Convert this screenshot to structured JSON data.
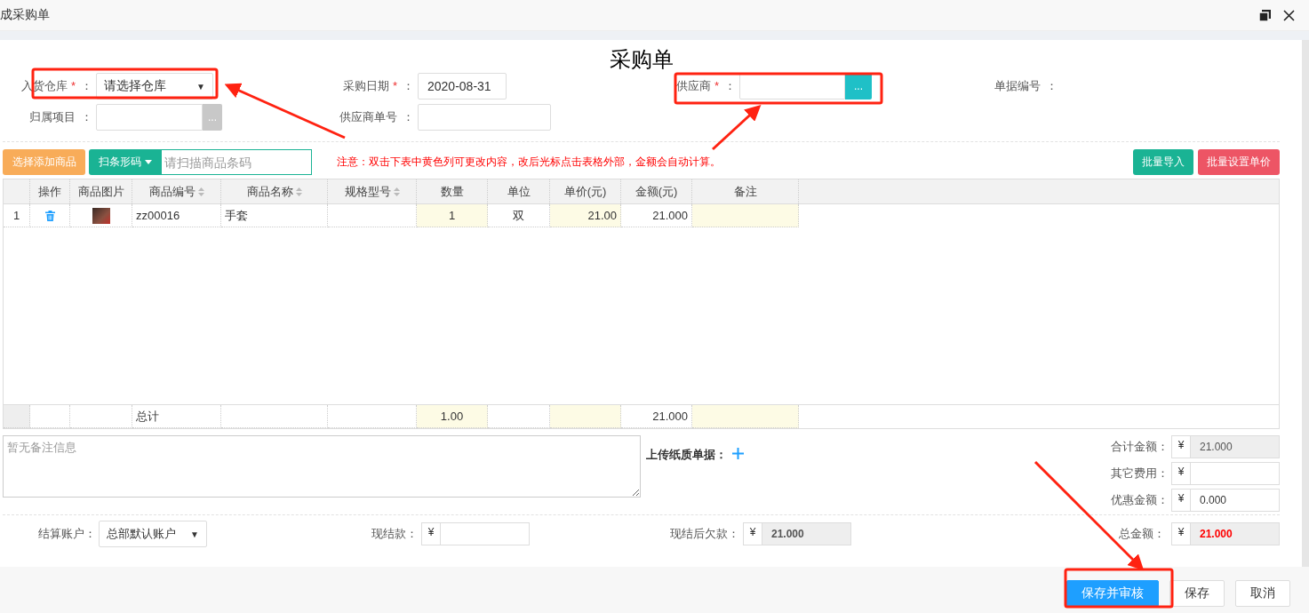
{
  "window": {
    "title": "成采购单"
  },
  "form": {
    "title": "采购单",
    "fields": [
      {
        "label": "入货仓库",
        "required_mark": "*",
        "colon": "：",
        "kind": "select",
        "value": "请选择仓库",
        "caret": "▼"
      },
      {
        "label": "采购日期",
        "required_mark": "*",
        "colon": "：",
        "kind": "text",
        "value": "2020-08-31"
      },
      {
        "label": "供应商",
        "required_mark": "*",
        "colon": "：",
        "kind": "lookup",
        "button": "..."
      },
      {
        "label": "单据编号",
        "colon": "：",
        "kind": "static"
      },
      {
        "label": "归属项目",
        "colon": "：",
        "kind": "picker",
        "button": "..."
      },
      {
        "label": "供应商单号",
        "colon": "：",
        "kind": "text"
      }
    ]
  },
  "toolbar": {
    "add_button": "选择添加商品",
    "scan_button": "扫条形码",
    "scan_placeholder": "请扫描商品条码",
    "notice": "注意：双击下表中黄色列可更改内容，改后光标点击表格外部，金额会自动计算。",
    "import_button": "批量导入",
    "set_price_button": "批量设置单价"
  },
  "table": {
    "columns": [
      {
        "label": "操作",
        "sortable": false,
        "editable": false
      },
      {
        "label": "商品图片",
        "sortable": false,
        "editable": false
      },
      {
        "label": "商品编号",
        "sortable": true,
        "editable": false
      },
      {
        "label": "商品名称",
        "sortable": true,
        "editable": false
      },
      {
        "label": "规格型号",
        "sortable": true,
        "editable": false
      },
      {
        "label": "数量",
        "sortable": false,
        "editable": true
      },
      {
        "label": "单位",
        "sortable": false,
        "editable": false
      },
      {
        "label": "单价(元)",
        "sortable": false,
        "editable": true
      },
      {
        "label": "金额(元)",
        "sortable": false,
        "editable": false
      },
      {
        "label": "备注",
        "sortable": false,
        "editable": true
      }
    ],
    "rows": [
      {
        "index": "1",
        "code": "zz00016",
        "name": "手套",
        "quantity": "1",
        "unit": "双",
        "price": "21.00",
        "amount": "21.000"
      }
    ],
    "total": {
      "code": "总计",
      "quantity": "1.00",
      "amount": "21.000"
    }
  },
  "remarks": {
    "placeholder": "暂无备注信息"
  },
  "upload": {
    "label": "上传纸质单据："
  },
  "amounts": [
    {
      "label": "合计金额：",
      "currency": "¥",
      "value": "21.000",
      "readonly": true
    },
    {
      "label": "其它费用：",
      "currency": "¥",
      "readonly": false
    },
    {
      "label": "优惠金额：",
      "currency": "¥",
      "value": "0.000",
      "readonly": false
    }
  ],
  "settlement": [
    {
      "label": "结算账户：",
      "kind": "select",
      "value": "总部默认账户",
      "caret": "▼"
    },
    {
      "label": "现结款：",
      "kind": "money",
      "currency": "¥",
      "readonly": false
    },
    {
      "label": "现结后欠款：",
      "kind": "money",
      "currency": "¥",
      "value": "21.000",
      "readonly": true,
      "emphasis": false
    },
    {
      "label": "总金额：",
      "kind": "money",
      "currency": "¥",
      "value": "21.000",
      "readonly": true,
      "emphasis": true
    }
  ],
  "buttons": [
    {
      "label": "保存并审核",
      "primary": true
    },
    {
      "label": "保存",
      "primary": false
    },
    {
      "label": "取消",
      "primary": false
    }
  ]
}
